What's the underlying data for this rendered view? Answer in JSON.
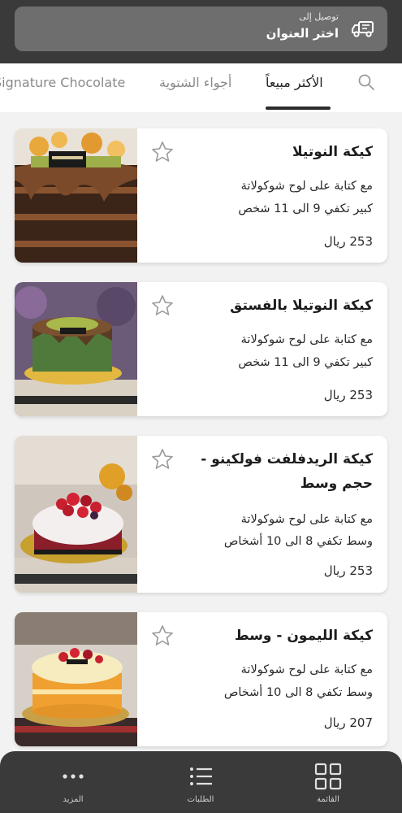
{
  "header": {
    "deliver_to_label": "توصيل إلى",
    "address_placeholder": "اختر العنوان",
    "truck_icon": "delivery-truck-icon"
  },
  "tabs": [
    {
      "label": "Signature Chocolate",
      "active": false
    },
    {
      "label": "أجواء الشتوية",
      "active": false
    },
    {
      "label": "الأكثر مبيعاً",
      "active": true
    }
  ],
  "products": [
    {
      "name": "كيكة النوتيلا",
      "desc_line1": "مع كتابة على لوح شوكولاتة",
      "desc_line2": "كبير تكفي 9 الى 11 شخص",
      "price": "253 ريال"
    },
    {
      "name": "كيكة النوتيلا بالفستق",
      "desc_line1": "مع كتابة على لوح شوكولاتة",
      "desc_line2": "كبير تكفي 9 الى 11 شخص",
      "price": "253 ريال"
    },
    {
      "name": "كيكة الريدفلفت فولكينو - حجم وسط",
      "desc_line1": "مع كتابة على لوح شوكولاتة",
      "desc_line2": "وسط تكفي  8 الى 10 أشخاص",
      "price": "253 ريال"
    },
    {
      "name": "كيكة الليمون - وسط",
      "desc_line1": "مع كتابة على لوح شوكولاتة",
      "desc_line2": "وسط تكفي  8 الى 10 أشخاص",
      "price": "207 ريال"
    }
  ],
  "bottom_nav": {
    "menu_label": "القائمة",
    "orders_label": "الطلبات",
    "more_label": "المزيد"
  },
  "colors": {
    "header_bg": "#3a3a3a",
    "address_bg": "#6e6e6e",
    "nav_bg": "#3a3a3a",
    "page_bg": "#f2f2f2"
  }
}
